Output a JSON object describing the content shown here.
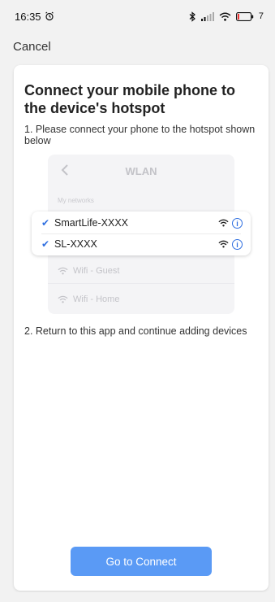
{
  "status_bar": {
    "time": "16:35",
    "battery": "7"
  },
  "header": {
    "cancel_label": "Cancel"
  },
  "main": {
    "title": "Connect your mobile phone to the device's hotspot",
    "step1": "1. Please connect your phone to the hotspot shown below",
    "step2": "2. Return to this app and continue adding devices",
    "illustration": {
      "header_title": "WLAN",
      "section_label": "My networks",
      "selected_networks": [
        "SmartLife-XXXX",
        "SL-XXXX"
      ],
      "other_networks": [
        "Wifi - Guest",
        "Wifi - Home"
      ]
    },
    "connect_button_label": "Go to Connect"
  },
  "colors": {
    "accent": "#5a9af5",
    "check": "#2f6fe0",
    "background": "#f2f2f2"
  }
}
